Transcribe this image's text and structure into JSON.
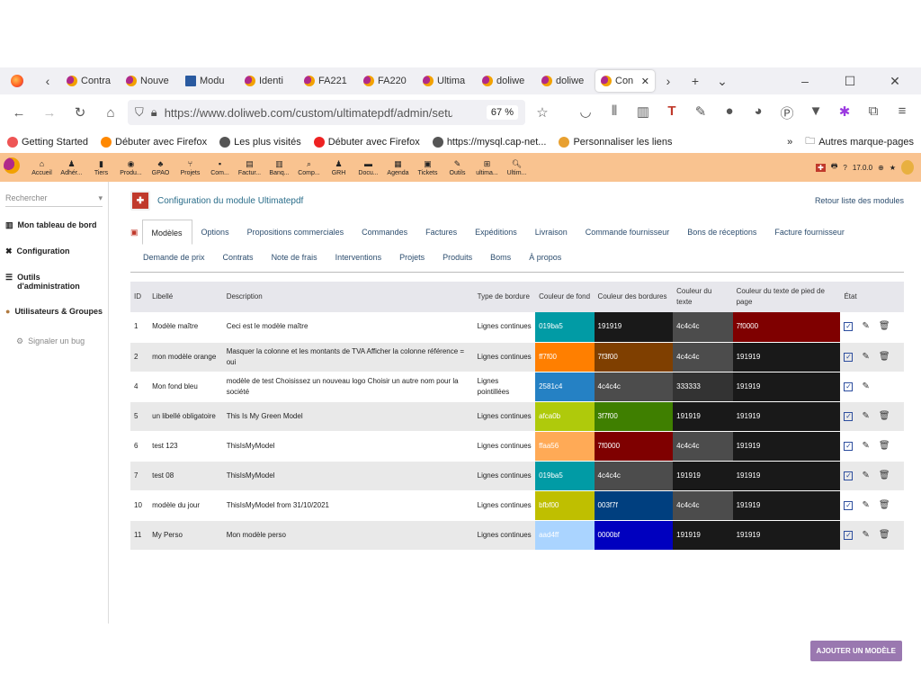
{
  "browser": {
    "tabs": [
      "Contra",
      "Nouve",
      "Modu",
      "Identi",
      "FA221",
      "FA220",
      "Ultima",
      "doliwe",
      "doliwe",
      "Con"
    ],
    "url": "https://www.doliweb.com/custom/ultimatepdf/admin/setup",
    "zoom": "67 %",
    "bookmarks": [
      "Getting Started",
      "Débuter avec Firefox",
      "Les plus visités",
      "Débuter avec Firefox",
      "https://mysql.cap-net...",
      "Personnaliser les liens"
    ],
    "other_bookmarks": "Autres marque-pages"
  },
  "topmenu": [
    "Accueil",
    "Adhér...",
    "Tiers",
    "Produ...",
    "GPAO",
    "Projets",
    "Com...",
    "Factur...",
    "Banq...",
    "Comp...",
    "GRH",
    "Docu...",
    "Agenda",
    "Tickets",
    "Outils",
    "ultima...",
    "Ultim..."
  ],
  "version": "17.0.0",
  "sidebar": {
    "search_placeholder": "Rechercher",
    "items": [
      "Mon tableau de bord",
      "Configuration",
      "Outils d'administration",
      "Utilisateurs & Groupes"
    ],
    "bug": "Signaler un bug"
  },
  "page": {
    "title": "Configuration du module Ultimatepdf",
    "back": "Retour liste des modules",
    "tabs_row1": [
      "Modèles",
      "Options",
      "Propositions commerciales",
      "Commandes",
      "Factures",
      "Expéditions",
      "Livraison",
      "Commande fournisseur",
      "Bons de réceptions",
      "Facture fournisseur"
    ],
    "tabs_row2": [
      "Demande de prix",
      "Contrats",
      "Note de frais",
      "Interventions",
      "Projets",
      "Produits",
      "Boms",
      "À propos"
    ],
    "add_button": "AJOUTER UN MODÈLE"
  },
  "table": {
    "headers": [
      "ID",
      "Libellé",
      "Description",
      "Type de bordure",
      "Couleur de fond",
      "Couleur des bordures",
      "Couleur du texte",
      "Couleur du texte de pied de page",
      "État"
    ],
    "rows": [
      {
        "id": "1",
        "label": "Modèle maître",
        "desc": "Ceci est le modèle maître",
        "border": "Lignes continues",
        "bg": "019ba5",
        "bd": "191919",
        "tx": "4c4c4c",
        "ft": "7f0000",
        "del": true
      },
      {
        "id": "2",
        "label": "mon modèle orange",
        "desc": "Masquer la colonne et les montants de TVA Afficher la colonne référence = oui",
        "border": "Lignes continues",
        "bg": "ff7f00",
        "bd": "7f3f00",
        "tx": "4c4c4c",
        "ft": "191919",
        "del": true
      },
      {
        "id": "4",
        "label": "Mon fond bleu",
        "desc": "modèle de test Choisissez un nouveau logo Choisir un autre nom pour la société",
        "border": "Lignes pointillées",
        "bg": "2581c4",
        "bd": "4c4c4c",
        "tx": "333333",
        "ft": "191919",
        "del": false
      },
      {
        "id": "5",
        "label": "un libellé obligatoire",
        "desc": "This Is My Green Model",
        "border": "Lignes continues",
        "bg": "afca0b",
        "bd": "3f7f00",
        "tx": "191919",
        "ft": "191919",
        "del": true
      },
      {
        "id": "6",
        "label": "test 123",
        "desc": "ThisIsMyModel",
        "border": "Lignes continues",
        "bg": "ffaa56",
        "bd": "7f0000",
        "tx": "4c4c4c",
        "ft": "191919",
        "del": true
      },
      {
        "id": "7",
        "label": "test 08",
        "desc": "ThisIsMyModel",
        "border": "Lignes continues",
        "bg": "019ba5",
        "bd": "4c4c4c",
        "tx": "191919",
        "ft": "191919",
        "del": true
      },
      {
        "id": "10",
        "label": "modèle du jour",
        "desc": "ThisIsMyModel from 31/10/2021",
        "border": "Lignes continues",
        "bg": "bfbf00",
        "bd": "003f7f",
        "tx": "4c4c4c",
        "ft": "191919",
        "del": true
      },
      {
        "id": "11",
        "label": "My Perso",
        "desc": "Mon modèle perso",
        "border": "Lignes continues",
        "bg": "aad4ff",
        "bd": "0000bf",
        "tx": "191919",
        "ft": "191919",
        "del": true
      }
    ]
  }
}
